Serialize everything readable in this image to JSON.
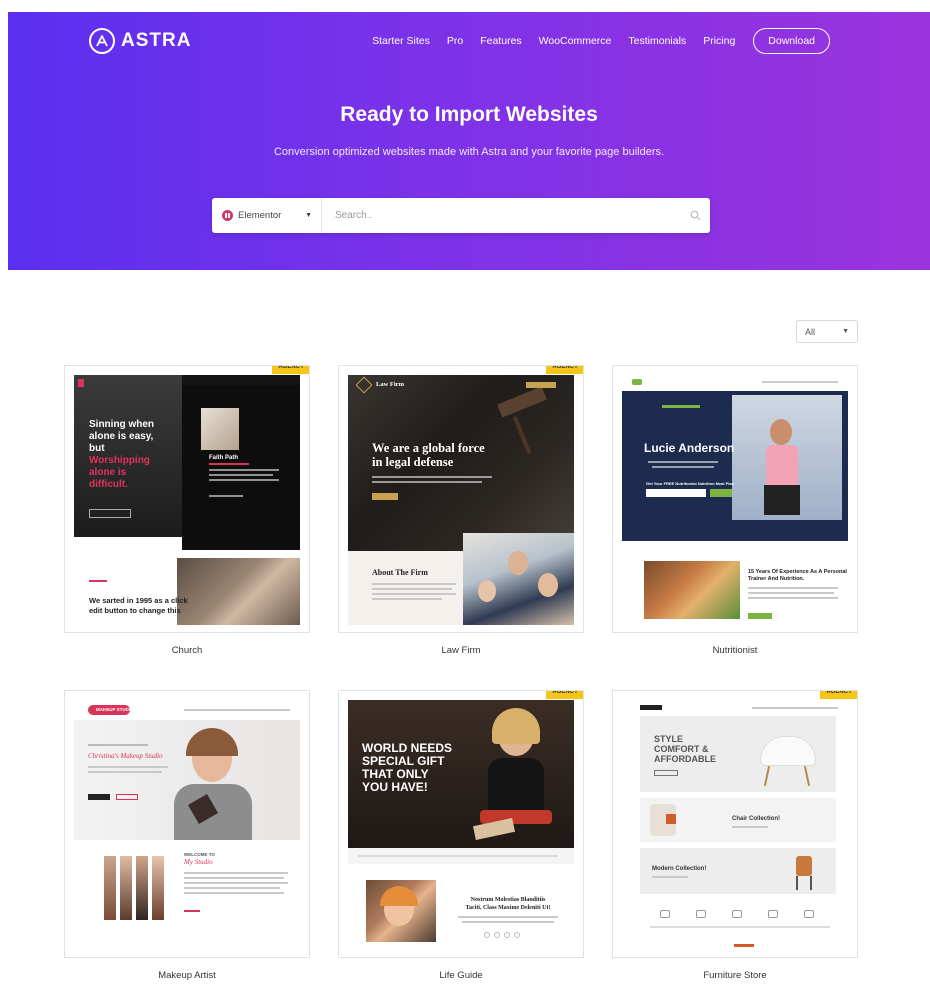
{
  "brand": {
    "name": "ASTRA"
  },
  "nav": {
    "items": [
      "Starter Sites",
      "Pro",
      "Features",
      "WooCommerce",
      "Testimonials",
      "Pricing"
    ],
    "download_label": "Download"
  },
  "hero": {
    "title": "Ready to Import Websites",
    "subtitle": "Conversion optimized websites made with Astra and your favorite page builders."
  },
  "search": {
    "builder_label": "Elementor",
    "placeholder": "Search.."
  },
  "filter": {
    "selected": "All"
  },
  "badge_label": "AGENCY",
  "colors": {
    "hero_gradient_start": "#5a2ff0",
    "hero_gradient_end": "#9a33de",
    "badge": "#f5c518",
    "elementor": "#d6336c"
  },
  "sites": [
    {
      "title": "Church",
      "agency": true,
      "preview": {
        "heading_1": "Sinning when",
        "heading_2": "alone is easy,",
        "heading_3": "but",
        "heading_4": "Worshipping",
        "heading_5": "alone is",
        "heading_6": "difficult.",
        "side_title": "Faith Path",
        "bottom_1": "We sarted in 1995 as a click",
        "bottom_2": "edit button to change this"
      }
    },
    {
      "title": "Law Firm",
      "agency": true,
      "preview": {
        "logo_text": "Law Firm",
        "headline_1": "We are a global force",
        "headline_2": "in legal defense",
        "section_title": "About The Firm"
      }
    },
    {
      "title": "Nutritionist",
      "agency": false,
      "preview": {
        "name": "Lucie Anderson",
        "offer": "Get Your FREE Nutritionist Nutrition Meal Plan",
        "years_1": "15 Years Of Experience As A Personal",
        "years_2": "Trainer And Nutrition."
      }
    },
    {
      "title": "Makeup Artist",
      "agency": false,
      "preview": {
        "logo_text": "MAKEUP STUDIO",
        "script_title": "Christina's Makeup Studio",
        "welcome": "WELCOME TO",
        "studio": "My Studio"
      }
    },
    {
      "title": "Life Guide",
      "agency": true,
      "preview": {
        "headline_1": "WORLD NEEDS",
        "headline_2": "SPECIAL GIFT",
        "headline_3": "THAT ONLY",
        "headline_4": "YOU HAVE!",
        "serif_1": "Nostrum Molestias Blanditiis",
        "serif_2": "Taciti, Class Maxime Deleniti Ut!"
      }
    },
    {
      "title": "Furniture Store",
      "agency": true,
      "preview": {
        "hero_1": "STYLE",
        "hero_2": "COMFORT &",
        "hero_3": "AFFORDABLE",
        "collection_1": "Chair Collection!",
        "collection_2": "Modern Collection!"
      }
    }
  ]
}
